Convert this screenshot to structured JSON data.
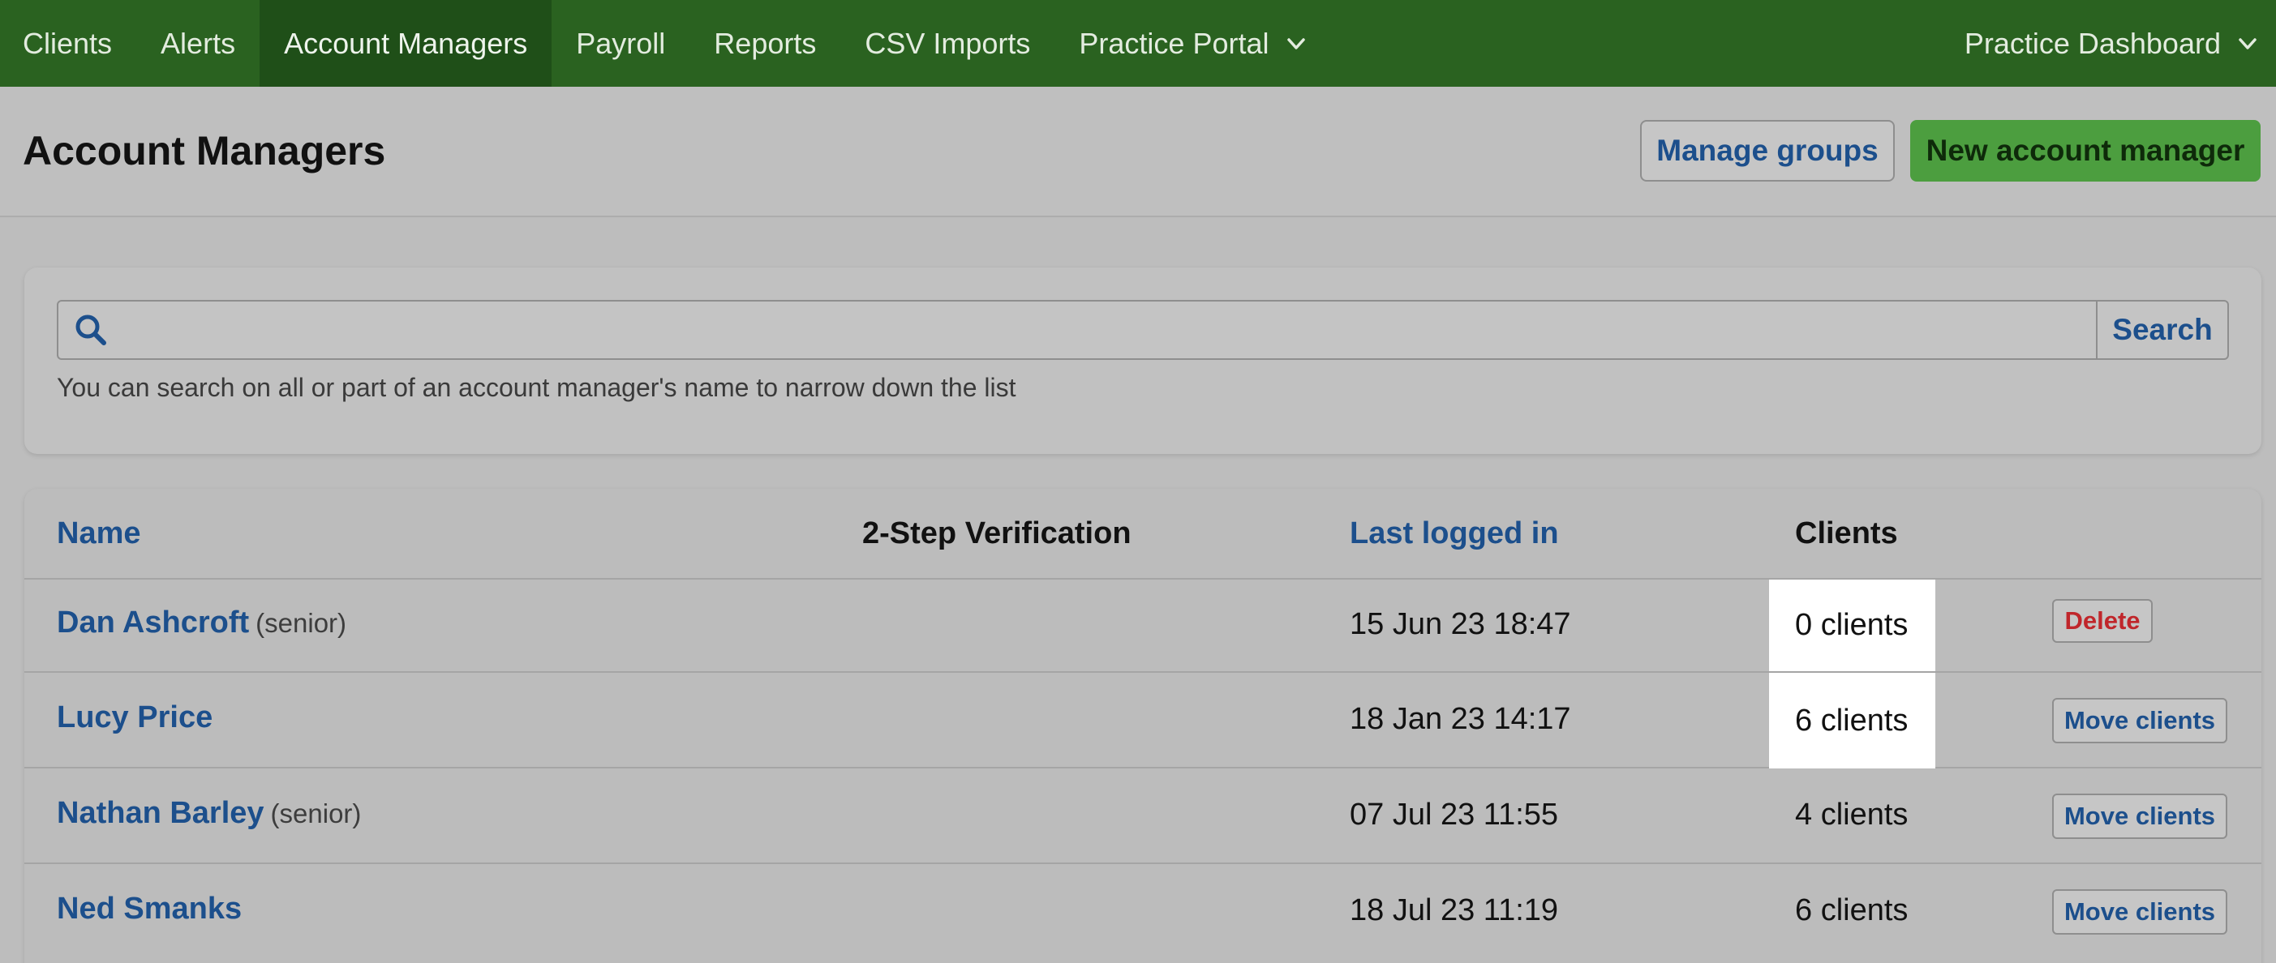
{
  "nav": {
    "items": [
      {
        "label": "Clients"
      },
      {
        "label": "Alerts"
      },
      {
        "label": "Account Managers"
      },
      {
        "label": "Payroll"
      },
      {
        "label": "Reports"
      },
      {
        "label": "CSV Imports"
      },
      {
        "label": "Practice Portal"
      }
    ],
    "right_label": "Practice Dashboard",
    "active": "Account Managers"
  },
  "header": {
    "title": "Account Managers",
    "manage_groups_label": "Manage groups",
    "new_manager_label": "New account manager"
  },
  "search": {
    "value": "",
    "placeholder": "",
    "button_label": "Search",
    "help_text": "You can search on all or part of an account manager's name to narrow down the list"
  },
  "table": {
    "columns": {
      "name": "Name",
      "two_step": "2-Step Verification",
      "last_logged_in": "Last logged in",
      "clients": "Clients"
    },
    "rows": [
      {
        "name": "Dan Ashcroft",
        "role": "(senior)",
        "last_logged_in": "15 Jun 23 18:47",
        "clients": "0 clients",
        "action": "Delete"
      },
      {
        "name": "Lucy Price",
        "role": "",
        "last_logged_in": "18 Jan 23 14:17",
        "clients": "6 clients",
        "action": "Move clients"
      },
      {
        "name": "Nathan Barley",
        "role": "(senior)",
        "last_logged_in": "07 Jul 23 11:55",
        "clients": "4 clients",
        "action": "Move clients"
      },
      {
        "name": "Ned Smanks",
        "role": "",
        "last_logged_in": "18 Jul 23 11:19",
        "clients": "6 clients",
        "action": "Move clients"
      }
    ]
  },
  "colors": {
    "nav_bg": "#2a6220",
    "nav_active_bg": "#1f4f18",
    "link_blue": "#1c4f8c",
    "primary_green": "#4c9e3f",
    "delete_red": "#c0262b",
    "highlight_white": "#ffffff"
  }
}
